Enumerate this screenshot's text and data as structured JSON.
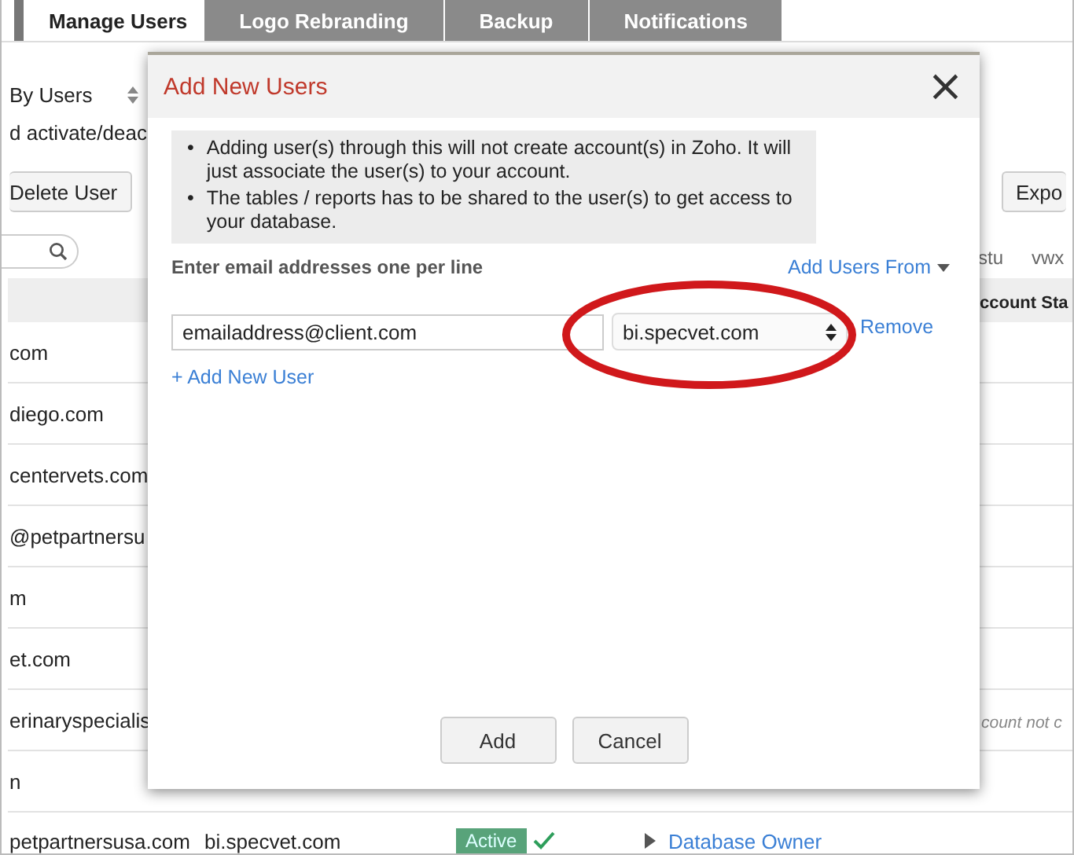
{
  "tabs": [
    {
      "label": "Manage Users",
      "selected": true
    },
    {
      "label": "Logo Rebranding",
      "selected": false
    },
    {
      "label": "Backup",
      "selected": false
    },
    {
      "label": "Notifications",
      "selected": false
    }
  ],
  "toolbar": {
    "filter_select": "By Users",
    "note": "d activate/deac",
    "delete_button": "Delete User",
    "export_button": "Expo",
    "alphabet_links": [
      "stu",
      "vwx"
    ]
  },
  "table": {
    "column_header": "ccount Sta",
    "rows": [
      {
        "email": "com"
      },
      {
        "email": "diego.com"
      },
      {
        "email": "centervets.com"
      },
      {
        "email": "@petpartnersu"
      },
      {
        "email": "m"
      },
      {
        "email": "et.com"
      },
      {
        "email": "erinaryspecialis",
        "status_note": "count not c"
      },
      {
        "email": "n"
      },
      {
        "email": "petpartnersusa.com",
        "domain": "bi.specvet.com",
        "status": "Active",
        "role": "Database Owner"
      }
    ]
  },
  "dialog": {
    "title": "Add New Users",
    "close": "×",
    "bullet": "•",
    "notes": [
      "Adding user(s) through this will not create account(s) in Zoho. It will just associate the user(s) to your account.",
      "The tables / reports has to be shared to the user(s) to get access to your database."
    ],
    "label": "Enter email addresses one per line",
    "add_users_from": "Add Users From",
    "entries": [
      {
        "email": "emailaddress@client.com",
        "domain": "bi.specvet.com",
        "remove": "Remove"
      }
    ],
    "add_link": "+ Add New User",
    "buttons": [
      "Add",
      "Cancel"
    ]
  }
}
